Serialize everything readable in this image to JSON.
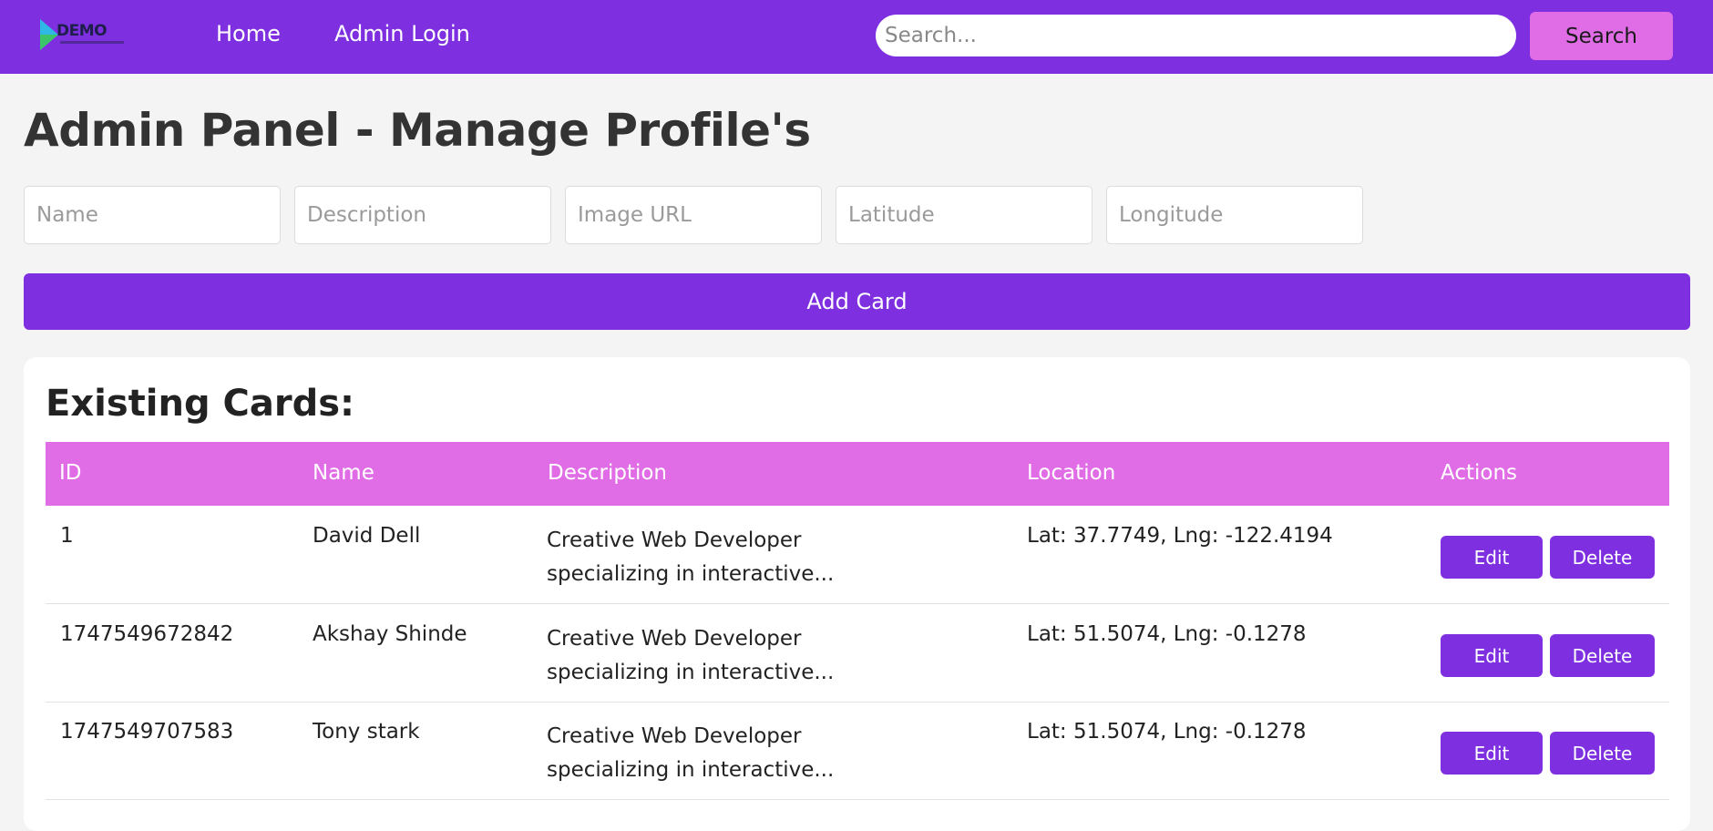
{
  "nav": {
    "logo_text": "DEMO",
    "links": [
      "Home",
      "Admin Login"
    ],
    "search_placeholder": "Search...",
    "search_button": "Search"
  },
  "page": {
    "title": "Admin Panel - Manage Profile's"
  },
  "form": {
    "name_placeholder": "Name",
    "description_placeholder": "Description",
    "image_placeholder": "Image URL",
    "latitude_placeholder": "Latitude",
    "longitude_placeholder": "Longitude",
    "add_button": "Add Card"
  },
  "table": {
    "title": "Existing Cards:",
    "headers": [
      "ID",
      "Name",
      "Description",
      "Location",
      "Actions"
    ],
    "rows": [
      {
        "id": "1",
        "name": "David Dell",
        "description": "Creative Web Developer specializing in interactive...",
        "location": "Lat: 37.7749, Lng: -122.4194",
        "edit": "Edit",
        "delete": "Delete"
      },
      {
        "id": "1747549672842",
        "name": "Akshay Shinde",
        "description": "Creative Web Developer specializing in interactive...",
        "location": "Lat: 51.5074, Lng: -0.1278",
        "edit": "Edit",
        "delete": "Delete"
      },
      {
        "id": "1747549707583",
        "name": "Tony stark",
        "description": "Creative Web Developer specializing in interactive...",
        "location": "Lat: 51.5074, Lng: -0.1278",
        "edit": "Edit",
        "delete": "Delete"
      }
    ]
  },
  "colors": {
    "primary": "#7e30e1",
    "accent": "#e06de6",
    "background": "#f4f4f4"
  }
}
